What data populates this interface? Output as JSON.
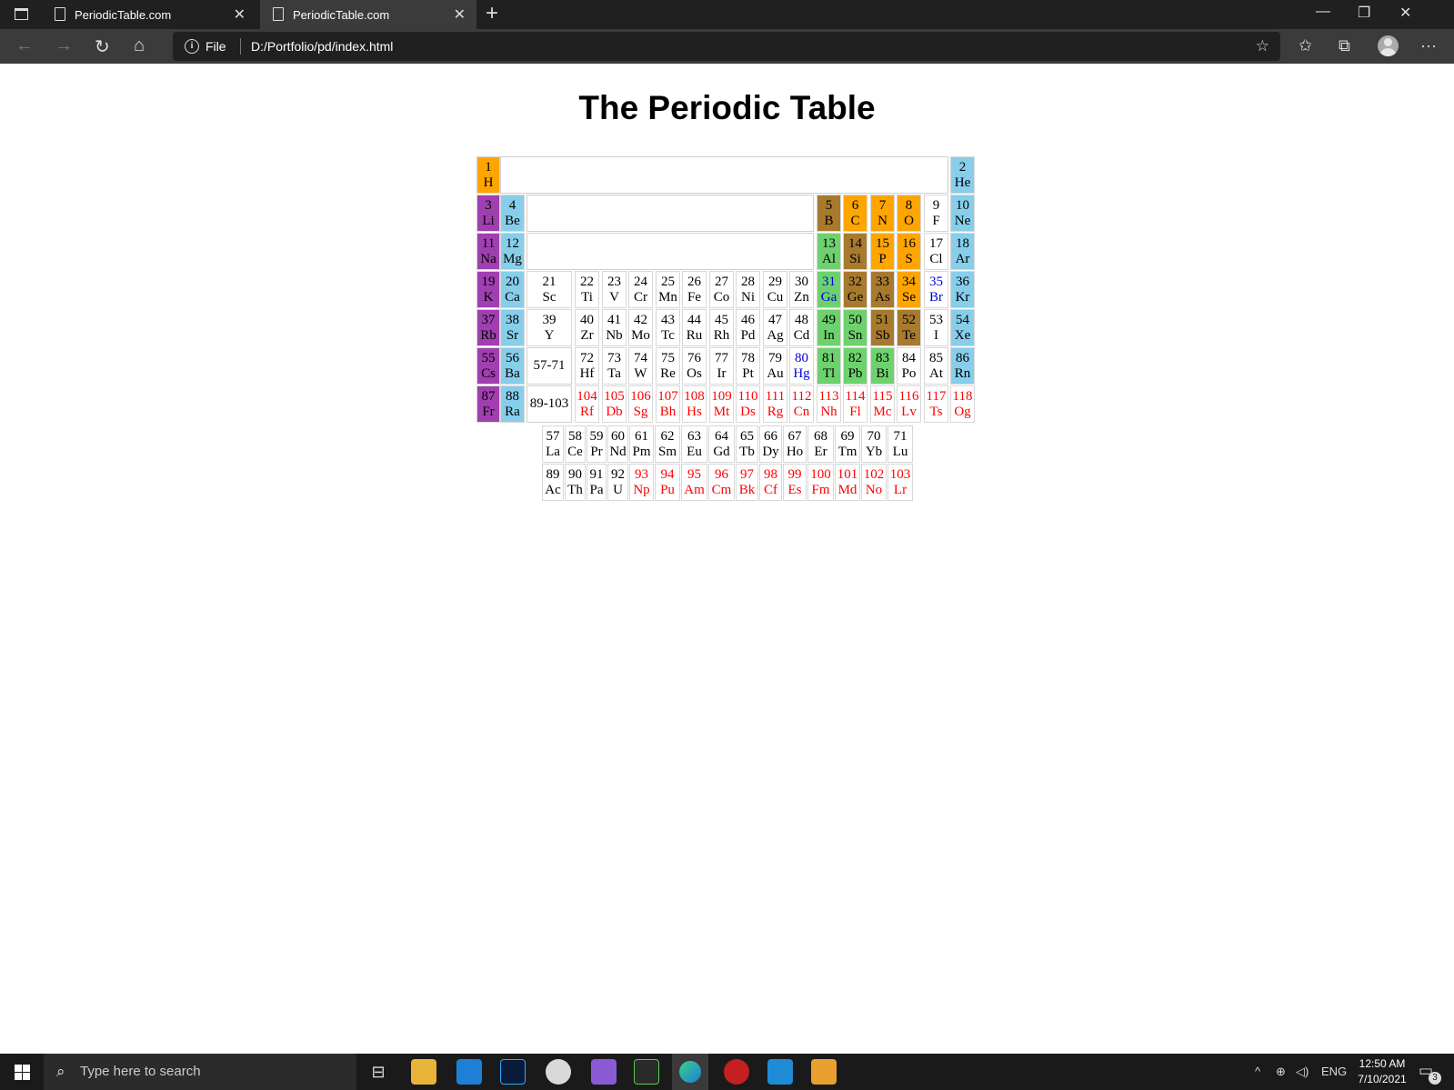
{
  "browser": {
    "tabs": [
      {
        "title": "PeriodicTable.com",
        "active": false
      },
      {
        "title": "PeriodicTable.com",
        "active": true
      }
    ],
    "address": {
      "scheme_label": "File",
      "url": "D:/Portfolio/pd/index.html"
    }
  },
  "page": {
    "title": "The Periodic Table"
  },
  "colors": {
    "alkali": "#a03fb0",
    "alkaline": "#87ceeb",
    "transition": "#ffff00",
    "post_transition": "#6dd26d",
    "metalloid": "#a87a2e",
    "nonmetal": "#ffa500",
    "noble": "#87ceeb",
    "text_blue": "#0000e0",
    "text_red": "#ff0000"
  },
  "table": {
    "main_rows": [
      [
        {
          "n": "1",
          "s": "H",
          "c": "nonmetal"
        },
        {
          "spacer": true
        },
        {
          "n": "2",
          "s": "He",
          "c": "noble"
        }
      ],
      [
        {
          "n": "3",
          "s": "Li",
          "c": "alkali"
        },
        {
          "n": "4",
          "s": "Be",
          "c": "alkaline"
        },
        {
          "spacer": true
        },
        {
          "n": "5",
          "s": "B",
          "c": "metalloid"
        },
        {
          "n": "6",
          "s": "C",
          "c": "nonmetal"
        },
        {
          "n": "7",
          "s": "N",
          "c": "nonmetal"
        },
        {
          "n": "8",
          "s": "O",
          "c": "nonmetal"
        },
        {
          "n": "9",
          "s": "F",
          "c": "white"
        },
        {
          "n": "10",
          "s": "Ne",
          "c": "noble"
        }
      ],
      [
        {
          "n": "11",
          "s": "Na",
          "c": "alkali"
        },
        {
          "n": "12",
          "s": "Mg",
          "c": "alkaline"
        },
        {
          "spacer": true
        },
        {
          "n": "13",
          "s": "Al",
          "c": "metal"
        },
        {
          "n": "14",
          "s": "Si",
          "c": "metalloid"
        },
        {
          "n": "15",
          "s": "P",
          "c": "nonmetal"
        },
        {
          "n": "16",
          "s": "S",
          "c": "nonmetal"
        },
        {
          "n": "17",
          "s": "Cl",
          "c": "white"
        },
        {
          "n": "18",
          "s": "Ar",
          "c": "noble"
        }
      ],
      [
        {
          "n": "19",
          "s": "K",
          "c": "alkali"
        },
        {
          "n": "20",
          "s": "Ca",
          "c": "alkaline"
        },
        {
          "n": "21",
          "s": "Sc",
          "c": "transition"
        },
        {
          "n": "22",
          "s": "Ti",
          "c": "transition"
        },
        {
          "n": "23",
          "s": "V",
          "c": "transition"
        },
        {
          "n": "24",
          "s": "Cr",
          "c": "transition"
        },
        {
          "n": "25",
          "s": "Mn",
          "c": "transition"
        },
        {
          "n": "26",
          "s": "Fe",
          "c": "transition"
        },
        {
          "n": "27",
          "s": "Co",
          "c": "transition"
        },
        {
          "n": "28",
          "s": "Ni",
          "c": "transition"
        },
        {
          "n": "29",
          "s": "Cu",
          "c": "transition"
        },
        {
          "n": "30",
          "s": "Zn",
          "c": "transition"
        },
        {
          "n": "31",
          "s": "Ga",
          "c": "metal",
          "t": "blue"
        },
        {
          "n": "32",
          "s": "Ge",
          "c": "metalloid"
        },
        {
          "n": "33",
          "s": "As",
          "c": "metalloid"
        },
        {
          "n": "34",
          "s": "Se",
          "c": "nonmetal"
        },
        {
          "n": "35",
          "s": "Br",
          "c": "white",
          "t": "blue"
        },
        {
          "n": "36",
          "s": "Kr",
          "c": "noble"
        }
      ],
      [
        {
          "n": "37",
          "s": "Rb",
          "c": "alkali"
        },
        {
          "n": "38",
          "s": "Sr",
          "c": "alkaline"
        },
        {
          "n": "39",
          "s": "Y",
          "c": "transition"
        },
        {
          "n": "40",
          "s": "Zr",
          "c": "transition"
        },
        {
          "n": "41",
          "s": "Nb",
          "c": "transition"
        },
        {
          "n": "42",
          "s": "Mo",
          "c": "transition"
        },
        {
          "n": "43",
          "s": "Tc",
          "c": "transition"
        },
        {
          "n": "44",
          "s": "Ru",
          "c": "transition"
        },
        {
          "n": "45",
          "s": "Rh",
          "c": "transition"
        },
        {
          "n": "46",
          "s": "Pd",
          "c": "transition"
        },
        {
          "n": "47",
          "s": "Ag",
          "c": "transition"
        },
        {
          "n": "48",
          "s": "Cd",
          "c": "transition"
        },
        {
          "n": "49",
          "s": "In",
          "c": "metal"
        },
        {
          "n": "50",
          "s": "Sn",
          "c": "metal"
        },
        {
          "n": "51",
          "s": "Sb",
          "c": "metalloid"
        },
        {
          "n": "52",
          "s": "Te",
          "c": "metalloid"
        },
        {
          "n": "53",
          "s": "I",
          "c": "white"
        },
        {
          "n": "54",
          "s": "Xe",
          "c": "noble"
        }
      ],
      [
        {
          "n": "55",
          "s": "Cs",
          "c": "alkali"
        },
        {
          "n": "56",
          "s": "Ba",
          "c": "alkaline"
        },
        {
          "range": "57-71"
        },
        {
          "n": "72",
          "s": "Hf",
          "c": "transition"
        },
        {
          "n": "73",
          "s": "Ta",
          "c": "transition"
        },
        {
          "n": "74",
          "s": "W",
          "c": "transition"
        },
        {
          "n": "75",
          "s": "Re",
          "c": "transition"
        },
        {
          "n": "76",
          "s": "Os",
          "c": "transition"
        },
        {
          "n": "77",
          "s": "Ir",
          "c": "transition"
        },
        {
          "n": "78",
          "s": "Pt",
          "c": "transition"
        },
        {
          "n": "79",
          "s": "Au",
          "c": "transition"
        },
        {
          "n": "80",
          "s": "Hg",
          "c": "transition",
          "t": "blue"
        },
        {
          "n": "81",
          "s": "Tl",
          "c": "metal"
        },
        {
          "n": "82",
          "s": "Pb",
          "c": "metal"
        },
        {
          "n": "83",
          "s": "Bi",
          "c": "metal"
        },
        {
          "n": "84",
          "s": "Po",
          "c": "white"
        },
        {
          "n": "85",
          "s": "At",
          "c": "white"
        },
        {
          "n": "86",
          "s": "Rn",
          "c": "noble"
        }
      ],
      [
        {
          "n": "87",
          "s": "Fr",
          "c": "alkali"
        },
        {
          "n": "88",
          "s": "Ra",
          "c": "alkaline"
        },
        {
          "range": "89-103"
        },
        {
          "n": "104",
          "s": "Rf",
          "c": "transition",
          "t": "red"
        },
        {
          "n": "105",
          "s": "Db",
          "c": "transition",
          "t": "red"
        },
        {
          "n": "106",
          "s": "Sg",
          "c": "transition",
          "t": "red"
        },
        {
          "n": "107",
          "s": "Bh",
          "c": "transition",
          "t": "red"
        },
        {
          "n": "108",
          "s": "Hs",
          "c": "transition",
          "t": "red"
        },
        {
          "n": "109",
          "s": "Mt",
          "c": "transition",
          "t": "red"
        },
        {
          "n": "110",
          "s": "Ds",
          "c": "transition",
          "t": "red"
        },
        {
          "n": "111",
          "s": "Rg",
          "c": "transition",
          "t": "red"
        },
        {
          "n": "112",
          "s": "Cn",
          "c": "transition",
          "t": "red"
        },
        {
          "n": "113",
          "s": "Nh",
          "c": "white",
          "t": "red"
        },
        {
          "n": "114",
          "s": "Fl",
          "c": "white",
          "t": "red"
        },
        {
          "n": "115",
          "s": "Mc",
          "c": "white",
          "t": "red"
        },
        {
          "n": "116",
          "s": "Lv",
          "c": "white",
          "t": "red"
        },
        {
          "n": "117",
          "s": "Ts",
          "c": "white",
          "t": "red"
        },
        {
          "n": "118",
          "s": "Og",
          "c": "white",
          "t": "red"
        }
      ]
    ],
    "f_rows": [
      [
        {
          "n": "57",
          "s": "La"
        },
        {
          "n": "58",
          "s": "Ce"
        },
        {
          "n": "59",
          "s": "Pr"
        },
        {
          "n": "60",
          "s": "Nd"
        },
        {
          "n": "61",
          "s": "Pm"
        },
        {
          "n": "62",
          "s": "Sm"
        },
        {
          "n": "63",
          "s": "Eu"
        },
        {
          "n": "64",
          "s": "Gd"
        },
        {
          "n": "65",
          "s": "Tb"
        },
        {
          "n": "66",
          "s": "Dy"
        },
        {
          "n": "67",
          "s": "Ho"
        },
        {
          "n": "68",
          "s": "Er"
        },
        {
          "n": "69",
          "s": "Tm"
        },
        {
          "n": "70",
          "s": "Yb"
        },
        {
          "n": "71",
          "s": "Lu"
        }
      ],
      [
        {
          "n": "89",
          "s": "Ac"
        },
        {
          "n": "90",
          "s": "Th"
        },
        {
          "n": "91",
          "s": "Pa"
        },
        {
          "n": "92",
          "s": "U"
        },
        {
          "n": "93",
          "s": "Np",
          "t": "red"
        },
        {
          "n": "94",
          "s": "Pu",
          "t": "red"
        },
        {
          "n": "95",
          "s": "Am",
          "t": "red"
        },
        {
          "n": "96",
          "s": "Cm",
          "t": "red"
        },
        {
          "n": "97",
          "s": "Bk",
          "t": "red"
        },
        {
          "n": "98",
          "s": "Cf",
          "t": "red"
        },
        {
          "n": "99",
          "s": "Es",
          "t": "red"
        },
        {
          "n": "100",
          "s": "Fm",
          "t": "red"
        },
        {
          "n": "101",
          "s": "Md",
          "t": "red"
        },
        {
          "n": "102",
          "s": "No",
          "t": "red"
        },
        {
          "n": "103",
          "s": "Lr",
          "t": "red"
        }
      ]
    ]
  },
  "taskbar": {
    "search_placeholder": "Type here to search",
    "language": "ENG",
    "time": "12:50 AM",
    "date": "7/10/2021",
    "notification_count": "3"
  }
}
